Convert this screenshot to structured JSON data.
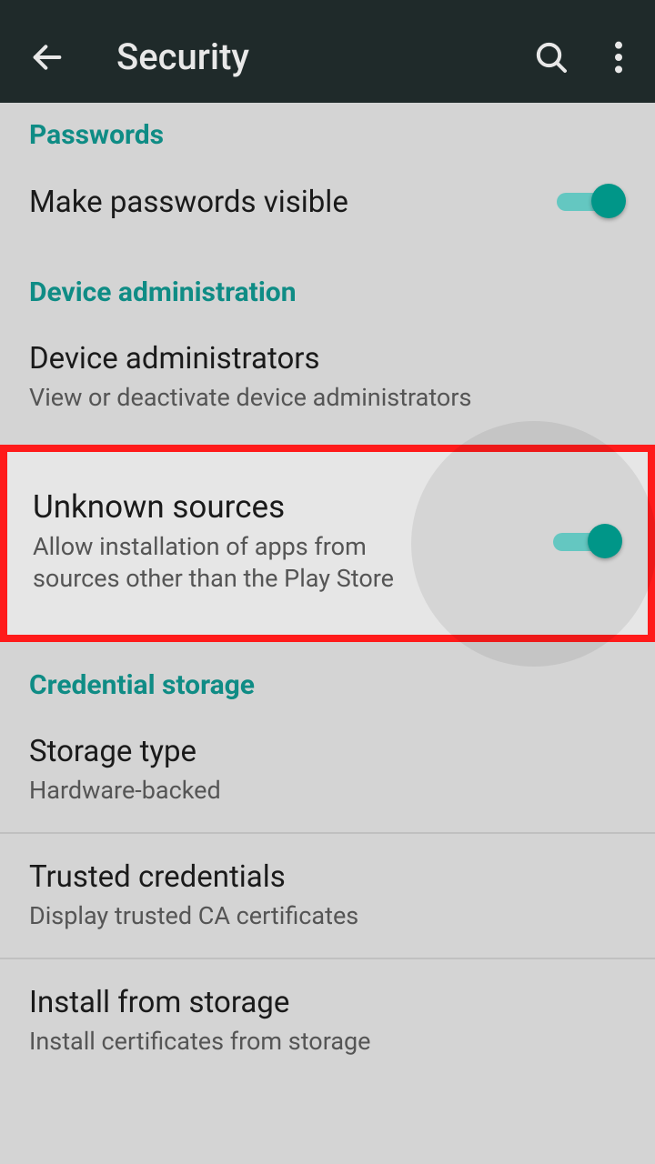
{
  "header": {
    "title": "Security"
  },
  "sections": {
    "passwords": {
      "label": "Passwords"
    },
    "device_admin": {
      "label": "Device administration"
    },
    "credential_storage": {
      "label": "Credential storage"
    }
  },
  "rows": {
    "make_passwords_visible": {
      "title": "Make passwords visible",
      "toggle": true
    },
    "device_administrators": {
      "title": "Device administrators",
      "sub": "View or deactivate device administrators"
    },
    "unknown_sources": {
      "title": "Unknown sources",
      "sub": "Allow installation of apps from sources other than the Play Store",
      "toggle": true
    },
    "storage_type": {
      "title": "Storage type",
      "sub": "Hardware-backed"
    },
    "trusted_credentials": {
      "title": "Trusted credentials",
      "sub": "Display trusted CA certificates"
    },
    "install_from_storage": {
      "title": "Install from storage",
      "sub": "Install certificates from storage"
    }
  },
  "colors": {
    "accent": "#009688",
    "highlight_border": "#ff1a1a"
  }
}
